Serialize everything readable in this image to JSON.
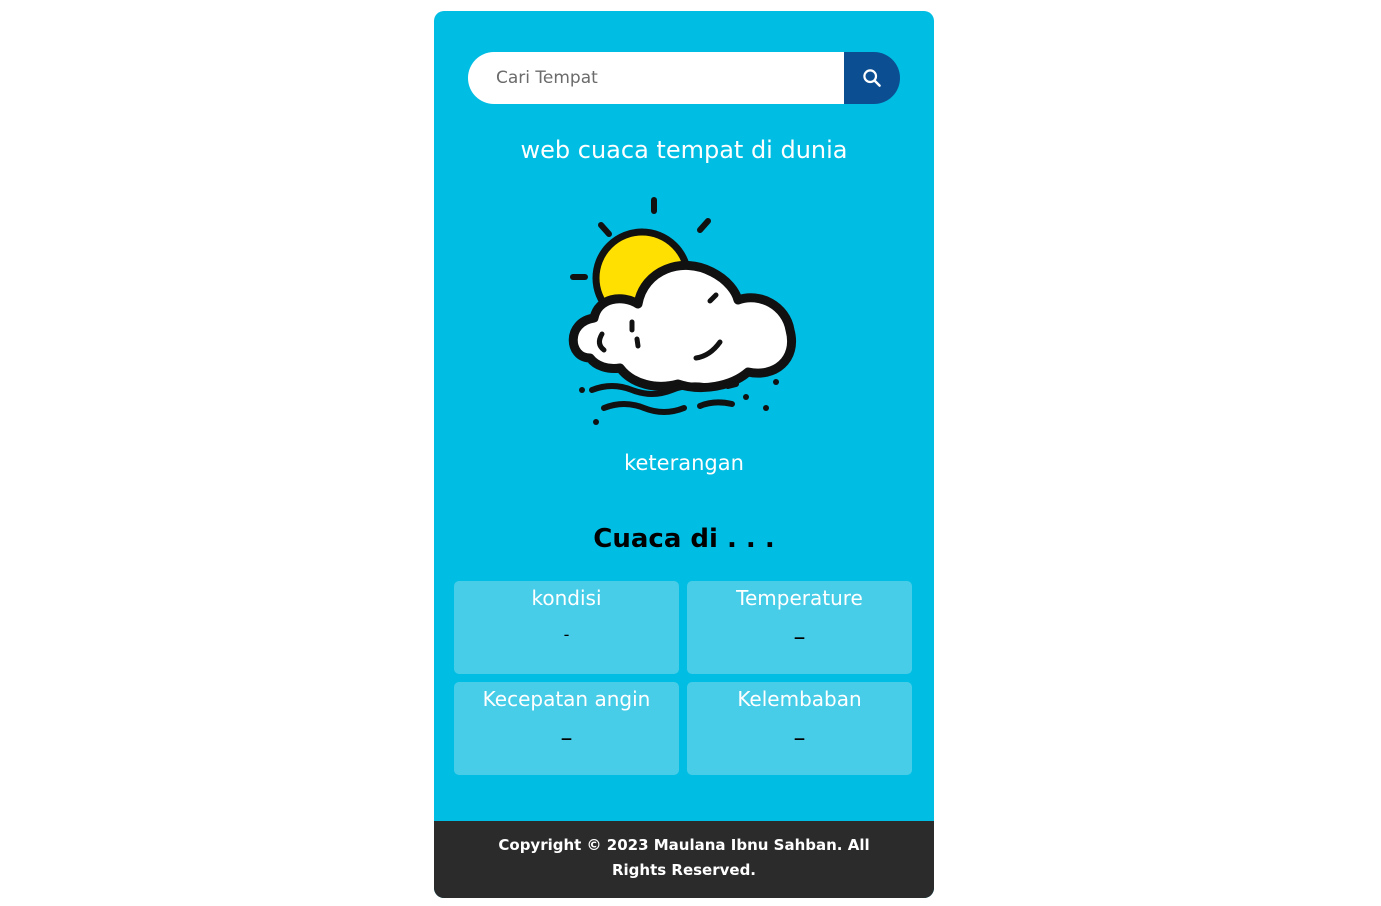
{
  "search": {
    "placeholder": "Cari Tempat",
    "value": "",
    "button_icon": "search-icon"
  },
  "header": {
    "title": "web cuaca tempat di dunia"
  },
  "weather": {
    "icon": "partly-cloudy-icon",
    "description": "keterangan",
    "location_title": "Cuaca di . . ."
  },
  "stats": [
    {
      "label": "kondisi",
      "value": "-"
    },
    {
      "label": "Temperature",
      "value": "–"
    },
    {
      "label": "Kecepatan angin",
      "value": "–"
    },
    {
      "label": "Kelembaban",
      "value": "–"
    }
  ],
  "footer": {
    "text": "Copyright © 2023 Maulana Ibnu Sahban. All Rights Reserved."
  },
  "colors": {
    "card_background": "#00bde3",
    "stat_box": "#48cde8",
    "search_button": "#0b4f92",
    "footer": "#2b2b2b",
    "sun": "#ffe000"
  }
}
